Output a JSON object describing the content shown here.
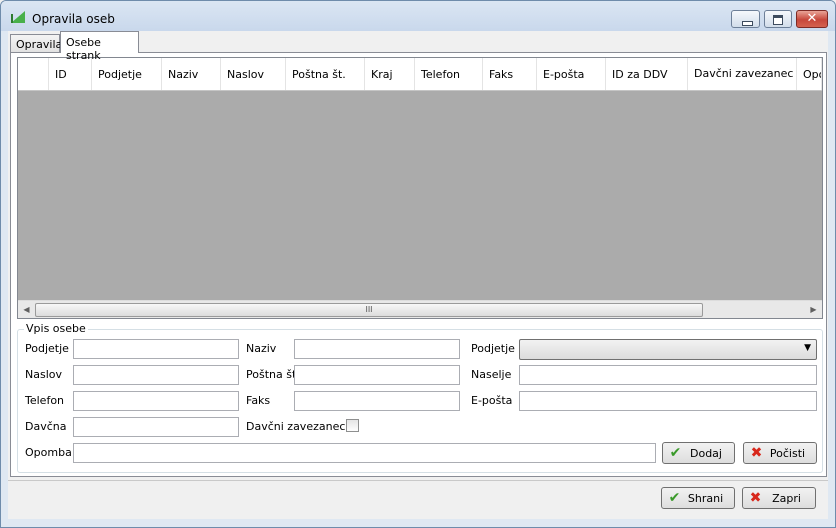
{
  "window": {
    "title": "Opravila oseb"
  },
  "tabs": [
    {
      "label": "Opravila"
    },
    {
      "label": "Osebe strank"
    }
  ],
  "grid": {
    "columns": [
      "ID",
      "Podjetje",
      "Naziv",
      "Naslov",
      "Poštna št.",
      "Kraj",
      "Telefon",
      "Faks",
      "E-pošta",
      "ID za DDV",
      "Davčni zavezanec",
      "Opo"
    ],
    "scroll_thumb": "III"
  },
  "form": {
    "legend": "Vpis osebe",
    "labels": {
      "podjetje": "Podjetje",
      "naziv": "Naziv",
      "podjetje2": "Podjetje",
      "naslov": "Naslov",
      "postna": "Poštna št.",
      "naselje": "Naselje",
      "telefon": "Telefon",
      "faks": "Faks",
      "eposta": "E-pošta",
      "davcna": "Davčna",
      "zavezanec": "Davčni zavezanec",
      "opomba": "Opomba"
    },
    "values": {
      "podjetje": "",
      "naziv": "",
      "podjetje2": "",
      "naslov": "",
      "postna": "",
      "naselje": "",
      "telefon": "",
      "faks": "",
      "eposta": "",
      "davcna": "",
      "opomba": ""
    }
  },
  "buttons": {
    "dodaj": "Dodaj",
    "pocisti": "Počisti",
    "shrani": "Shrani",
    "zapri": "Zapri"
  },
  "colors": {
    "check": "#3a9a2a",
    "cross": "#d8281c"
  }
}
